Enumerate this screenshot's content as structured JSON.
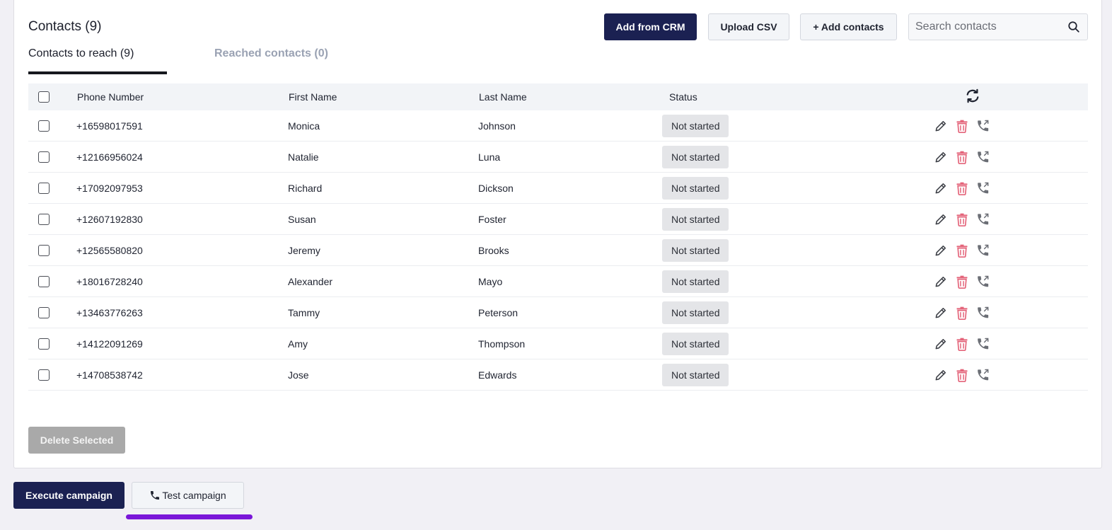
{
  "header": {
    "title": "Contacts (9)",
    "add_from_crm": "Add from CRM",
    "upload_csv": "Upload CSV",
    "add_contacts": "+ Add contacts",
    "search_placeholder": "Search contacts"
  },
  "tabs": {
    "active": "Contacts to reach (9)",
    "inactive": "Reached contacts (0)"
  },
  "table": {
    "columns": [
      "Phone Number",
      "First Name",
      "Last Name",
      "Status"
    ],
    "rows": [
      {
        "phone": "+16598017591",
        "first": "Monica",
        "last": "Johnson",
        "status": "Not started"
      },
      {
        "phone": "+12166956024",
        "first": "Natalie",
        "last": "Luna",
        "status": "Not started"
      },
      {
        "phone": "+17092097953",
        "first": "Richard",
        "last": "Dickson",
        "status": "Not started"
      },
      {
        "phone": "+12607192830",
        "first": "Susan",
        "last": "Foster",
        "status": "Not started"
      },
      {
        "phone": "+12565580820",
        "first": "Jeremy",
        "last": "Brooks",
        "status": "Not started"
      },
      {
        "phone": "+18016728240",
        "first": "Alexander",
        "last": "Mayo",
        "status": "Not started"
      },
      {
        "phone": "+13463776263",
        "first": "Tammy",
        "last": "Peterson",
        "status": "Not started"
      },
      {
        "phone": "+14122091269",
        "first": "Amy",
        "last": "Thompson",
        "status": "Not started"
      },
      {
        "phone": "+14708538742",
        "first": "Jose",
        "last": "Edwards",
        "status": "Not started"
      }
    ],
    "row_icons": [
      "pencil-icon",
      "trash-icon",
      "phone-forward-icon"
    ],
    "header_icon": "refresh-icon"
  },
  "footer": {
    "delete_selected": "Delete Selected",
    "execute_campaign": "Execute campaign",
    "test_campaign": "Test campaign"
  },
  "colors": {
    "primary": "#1b2152",
    "delete_icon": "#e4647a",
    "accent_line": "#7a16d8"
  }
}
